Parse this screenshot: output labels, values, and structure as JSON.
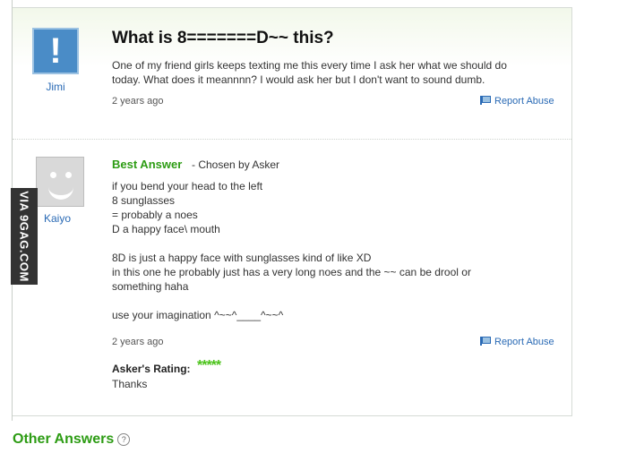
{
  "question": {
    "title": "What is 8=======D~~ this?",
    "asker": "Jimi",
    "body_lines": [
      "One of my friend girls keeps texting me this every time I ask her what we should do",
      "today. What does it meannnn? I would ask her but I don't want to sound dumb."
    ],
    "time": "2 years ago",
    "report_label": "Report Abuse"
  },
  "answer": {
    "answerer": "Kaiyo",
    "best_answer_label": "Best Answer",
    "chosen_label": "- Chosen by Asker",
    "body_lines": [
      "if you bend your head to the left",
      "8 sunglasses",
      "= probably a noes",
      "D a happy face\\ mouth",
      "",
      "8D is just a happy face with sunglasses kind of like XD",
      "in this one he probably just has a very long noes and the ~~ can be drool or",
      "something haha",
      "",
      "use your imagination ^~~^____^~~^"
    ],
    "time": "2 years ago",
    "report_label": "Report Abuse",
    "rating_label": "Asker's Rating:",
    "rating_stars": "*****",
    "rating_comment": "Thanks"
  },
  "watermark": "VIA 9GAG.COM",
  "other_answers": {
    "label": "Other Answers",
    "help_icon": "?"
  },
  "colors": {
    "best_answer_green": "#2d9c14",
    "link_blue": "#2a6ab5",
    "stars_green": "#4cc31b"
  }
}
